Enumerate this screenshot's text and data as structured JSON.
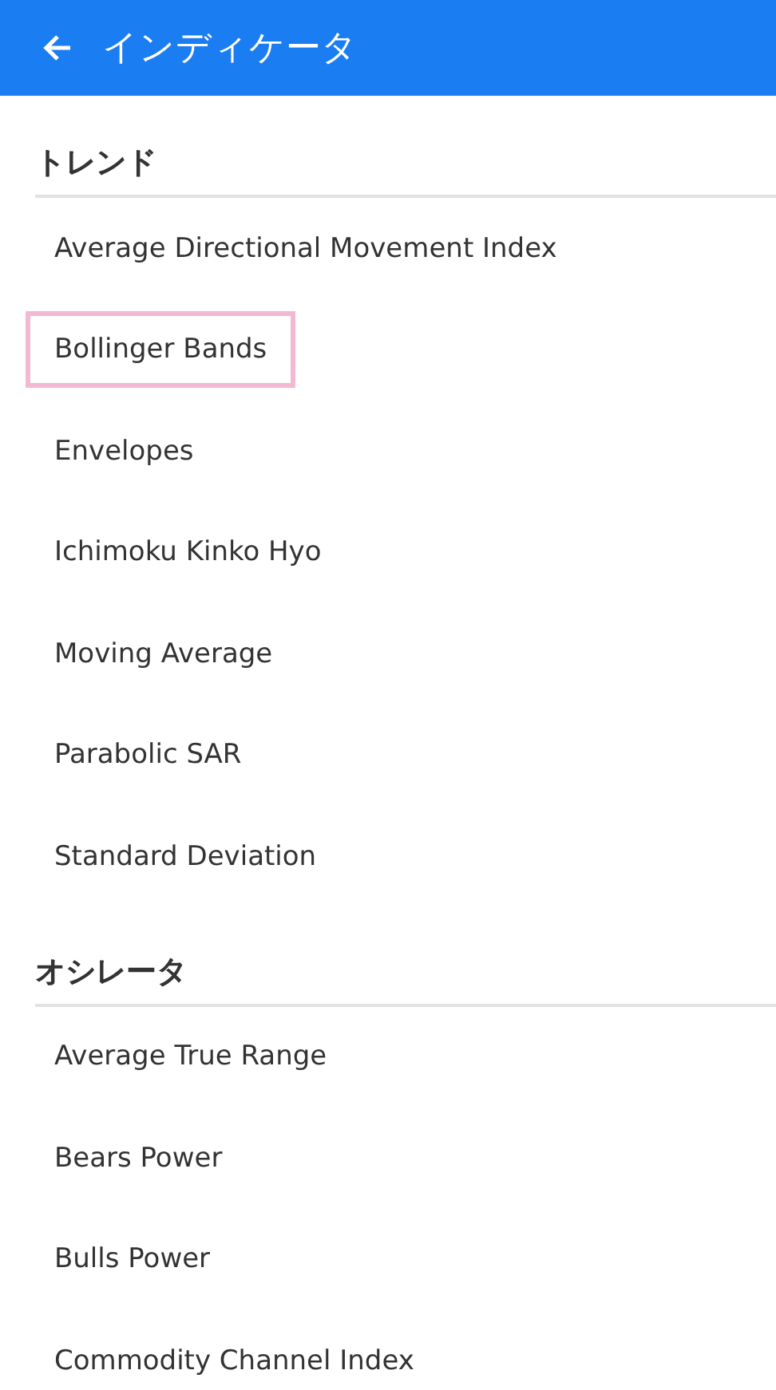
{
  "app_bar": {
    "title": "インディケータ"
  },
  "sections": [
    {
      "title": "トレンド",
      "items": [
        {
          "label": "Average Directional Movement Index",
          "highlighted": false
        },
        {
          "label": "Bollinger Bands",
          "highlighted": true
        },
        {
          "label": "Envelopes",
          "highlighted": false
        },
        {
          "label": "Ichimoku Kinko Hyo",
          "highlighted": false
        },
        {
          "label": "Moving Average",
          "highlighted": false
        },
        {
          "label": "Parabolic SAR",
          "highlighted": false
        },
        {
          "label": "Standard Deviation",
          "highlighted": false
        }
      ]
    },
    {
      "title": "オシレータ",
      "items": [
        {
          "label": "Average True Range",
          "highlighted": false
        },
        {
          "label": "Bears Power",
          "highlighted": false
        },
        {
          "label": "Bulls Power",
          "highlighted": false
        },
        {
          "label": "Commodity Channel Index",
          "highlighted": false
        }
      ]
    }
  ]
}
